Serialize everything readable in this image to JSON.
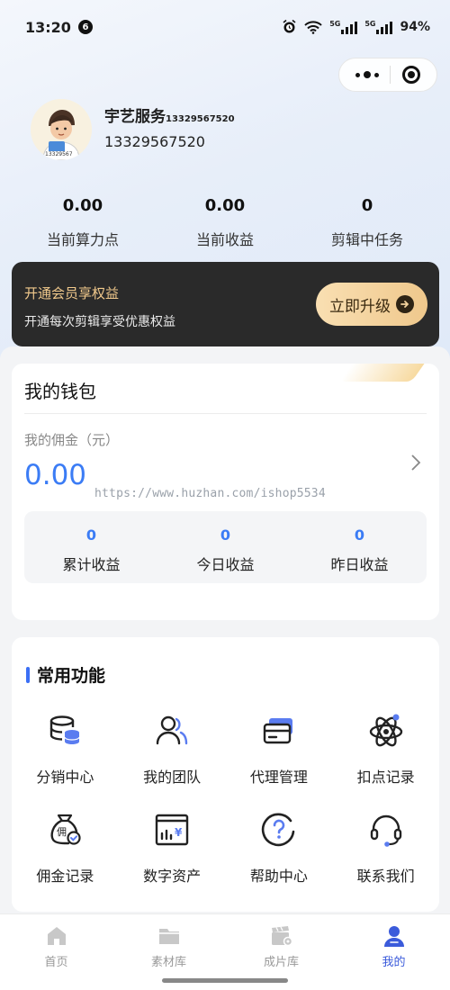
{
  "status_bar": {
    "time": "13:20",
    "notif_count": "6",
    "net1": "5G",
    "net2": "5G",
    "battery": "94%"
  },
  "profile": {
    "name": "宇艺服务",
    "name_suffix": "13329567520",
    "phone": "13329567520",
    "avatar_badge": "13329567"
  },
  "stats": [
    {
      "value": "0.00",
      "label": "当前算力点"
    },
    {
      "value": "0.00",
      "label": "当前收益"
    },
    {
      "value": "0",
      "label": "剪辑中任务"
    }
  ],
  "vip": {
    "title": "开通会员享权益",
    "desc": "开通每次剪辑享受优惠权益",
    "button": "立即升级"
  },
  "wallet": {
    "title": "我的钱包",
    "commission_label": "我的佣金（元）",
    "commission_value": "0.00",
    "watermark": "https://www.huzhan.com/ishop5534",
    "earnings": [
      {
        "value": "0",
        "label": "累计收益"
      },
      {
        "value": "0",
        "label": "今日收益"
      },
      {
        "value": "0",
        "label": "昨日收益"
      }
    ]
  },
  "features": {
    "title": "常用功能",
    "items": [
      {
        "label": "分销中心",
        "icon": "database-icon"
      },
      {
        "label": "我的团队",
        "icon": "team-icon"
      },
      {
        "label": "代理管理",
        "icon": "card-icon"
      },
      {
        "label": "扣点记录",
        "icon": "atom-icon"
      },
      {
        "label": "佣金记录",
        "icon": "money-bag-icon"
      },
      {
        "label": "数字资产",
        "icon": "asset-chart-icon"
      },
      {
        "label": "帮助中心",
        "icon": "help-icon"
      },
      {
        "label": "联系我们",
        "icon": "headset-icon"
      }
    ]
  },
  "tabbar": [
    {
      "label": "首页",
      "icon": "home-icon"
    },
    {
      "label": "素材库",
      "icon": "folder-icon"
    },
    {
      "label": "成片库",
      "icon": "clapper-icon"
    },
    {
      "label": "我的",
      "icon": "person-icon"
    }
  ],
  "colors": {
    "accent": "#3b7cf5",
    "vip_bg": "#2a2a2a",
    "vip_gold": "#f1c98c",
    "tab_active": "#3b5bdb"
  }
}
